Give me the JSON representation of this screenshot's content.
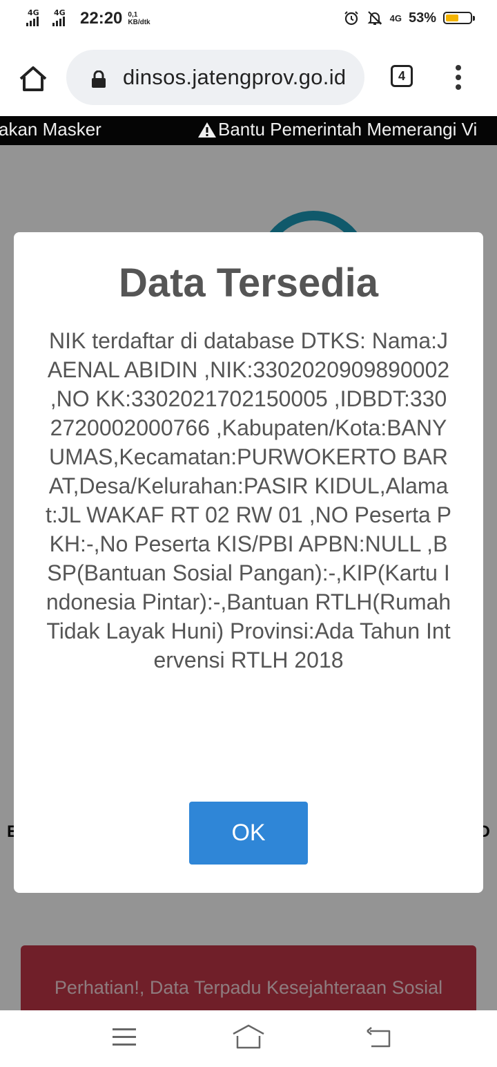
{
  "status_bar": {
    "network1": "4G",
    "network2": "4G",
    "time": "22:20",
    "speed_value": "0,1",
    "speed_unit": "KB/dtk",
    "net3": "4G",
    "battery_percent": "53%",
    "battery_level": 0.53,
    "battery_color": "#f3b300"
  },
  "browser": {
    "url": "dinsos.jatengprov.go.id",
    "tab_count": "4"
  },
  "marquee": {
    "left_text": "akan Masker",
    "right_text": "Bantu Pemerintah Memerangi Vi"
  },
  "page": {
    "alert_text": "Perhatian!, Data Terpadu Kesejahteraan Sosial",
    "bg_left_letter": "E",
    "bg_right_letter": "D"
  },
  "dialog": {
    "title": "Data Tersedia",
    "body": "NIK terdaftar di database DTKS: Nama:JAENAL ABIDIN ,NIK:3302020909890002 ,NO KK:3302021702150005 ,IDBDT:3302720002000766 ,Kabupaten/Kota:BANYUMAS,Kecamatan:PURWOKERTO BARAT,Desa/Kelurahan:PASIR KIDUL,Alamat:JL WAKAF RT 02 RW 01 ,NO Peserta PKH:-,No Peserta KIS/PBI APBN:NULL ,BSP(Bantuan Sosial Pangan):-,KIP(Kartu Indonesia Pintar):-,Bantuan RTLH(Rumah Tidak Layak Huni) Provinsi:Ada Tahun Intervensi RTLH 2018",
    "ok_label": "OK",
    "ok_color": "#2f86d7"
  },
  "nav_bar": {
    "icons": [
      "menu-icon",
      "home-icon",
      "back-icon"
    ]
  }
}
